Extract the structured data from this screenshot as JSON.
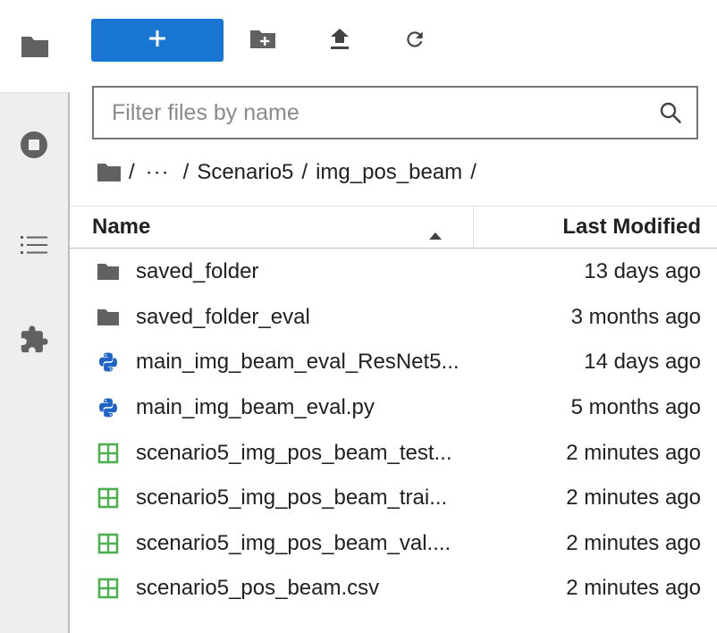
{
  "sidebar": {
    "tabs": [
      {
        "icon": "folder-icon",
        "active": true
      },
      {
        "icon": "stop-circle-icon",
        "active": false
      },
      {
        "icon": "list-icon",
        "active": false
      },
      {
        "icon": "puzzle-icon",
        "active": false
      }
    ]
  },
  "toolbar": {
    "new_label": "+",
    "new_folder_icon": "new-folder-icon",
    "upload_icon": "upload-icon",
    "refresh_icon": "refresh-icon"
  },
  "filter": {
    "placeholder": "Filter files by name",
    "value": ""
  },
  "breadcrumbs": {
    "root": "/",
    "ellipsis": "···",
    "items": [
      "Scenario5",
      "img_pos_beam"
    ],
    "separator": "/"
  },
  "columns": {
    "name": "Name",
    "modified": "Last Modified",
    "sort": "ascending"
  },
  "files": [
    {
      "name": "saved_folder",
      "type": "folder",
      "modified": "13 days ago"
    },
    {
      "name": "saved_folder_eval",
      "type": "folder",
      "modified": "3 months ago"
    },
    {
      "name": "main_img_beam_eval_ResNet5...",
      "type": "python",
      "modified": "14 days ago"
    },
    {
      "name": "main_img_beam_eval.py",
      "type": "python",
      "modified": "5 months ago"
    },
    {
      "name": "scenario5_img_pos_beam_test...",
      "type": "csv",
      "modified": "2 minutes ago"
    },
    {
      "name": "scenario5_img_pos_beam_trai...",
      "type": "csv",
      "modified": "2 minutes ago"
    },
    {
      "name": "scenario5_img_pos_beam_val....",
      "type": "csv",
      "modified": "2 minutes ago"
    },
    {
      "name": "scenario5_pos_beam.csv",
      "type": "csv",
      "modified": "2 minutes ago"
    }
  ],
  "colors": {
    "accent": "#1976d2",
    "csv_icon": "#4caf50",
    "python_blue": "#1e63c6",
    "python_yellow": "#ffc107",
    "icon_gray": "#616161"
  }
}
